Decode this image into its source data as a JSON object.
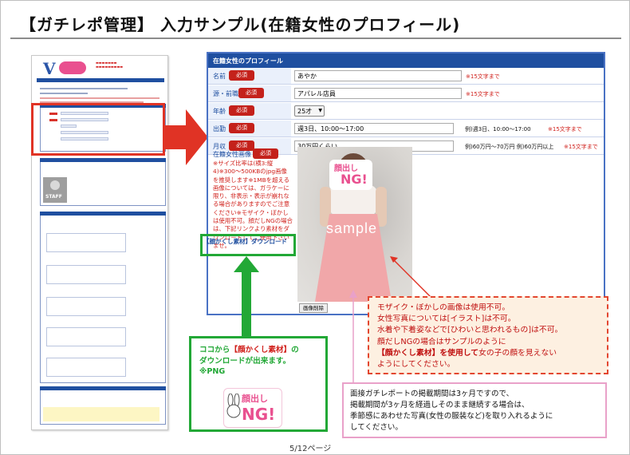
{
  "slide": {
    "title": "【ガチレポ管理】 入力サンプル(在籍女性のプロフィール)",
    "page_number": "5/12ページ"
  },
  "form": {
    "header": "在籍女性のプロフィール",
    "required_label": "必須",
    "rows": [
      {
        "label": "名前",
        "value": "あやか",
        "note": "※15文字まで"
      },
      {
        "label": "源・前職",
        "value": "アパレル店員",
        "note": "※15文字まで"
      },
      {
        "label": "年齢",
        "value": "25才"
      },
      {
        "label": "出勤",
        "value": "週3日、10:00〜17:00",
        "example": "例)週3日、10:00〜17:00",
        "note": "※15文字まで"
      },
      {
        "label": "月収",
        "value": "30万円くらい",
        "example": "例)60万円〜70万円 例)60万円以上",
        "note": "※15文字まで"
      }
    ],
    "image_label": "在籍女性画像",
    "image_notes": "※サイズ比率は(横3:縦4)※300〜500KBのjpg画像を推奨します※1MBを超える画像については、ガラケーに限り、非表示・表示が崩れなる場合がありますのでご注意ください※モザイク・ぼかしは使用不可。顔だしNGの場合は、下記リンクより素材をダウンロードしてご使用下さいませ。",
    "download_link": "【顔かくし素材】ダウンロード",
    "photo_sample": "sample",
    "badge_text_1": "顔出し",
    "badge_text_2": "NG!",
    "delete_button": "画像削除"
  },
  "thumbnail": {
    "staff_label": "STAFF"
  },
  "callouts": {
    "green": {
      "line1a": "ココから",
      "line1b": "【顔かくし素材】",
      "line1c": "の",
      "line2": "ダウンロードが出来ます。",
      "line3": "※PNG",
      "badge_1": "顔出し",
      "badge_2": "NG!"
    },
    "orange": {
      "l1": "モザイク・ぼかしの画像は使用不可。",
      "l2": "女性写真については[イラスト]は不可。",
      "l3": "水着や下着姿などで[ひわいと思われるもの]は不可。",
      "l4": "顔だしNGの場合はサンプルのように",
      "l5a": "【顔かくし素材】を使用して",
      "l5b": "女の子の顔を見えない",
      "l6": "ようにしてください。"
    },
    "pink": {
      "l1": "面接ガチレポートの掲載期間は3ヶ月ですので、",
      "l2": "掲載期間が3ヶ月を経過しそのまま継続する場合は、",
      "l3": "季節感にあわせた写真(女性の服装など)を取り入れるように",
      "l4": "してください。"
    }
  },
  "colors": {
    "accent_blue": "#1f4fa0",
    "required_red": "#c4211b",
    "arrow_red": "#e03325",
    "green": "#22a836",
    "pink": "#e9508f"
  }
}
